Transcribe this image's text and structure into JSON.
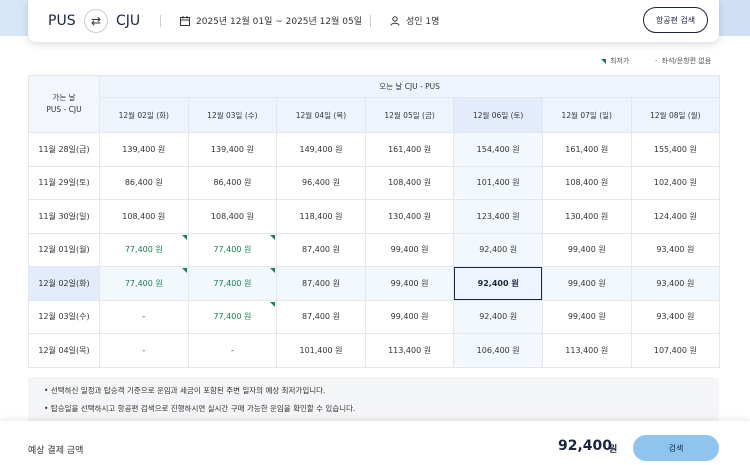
{
  "search": {
    "origin": "PUS",
    "destination": "CJU",
    "swap_icon": "⇄",
    "date_range": "2025년 12월 01일 ~ 2025년 12월 05일",
    "passengers": "성인 1명",
    "search_flight_label": "항공편 검색"
  },
  "legend": {
    "lowest_label": "최저가",
    "none_symbol": "-",
    "none_label": "좌석/운항편 없음"
  },
  "table": {
    "return_header": "오는 날 CJU - PUS",
    "corner_line1": "가는 날",
    "corner_line2": "PUS - CJU",
    "return_dates": [
      "12월 02일 (화)",
      "12월 03일 (수)",
      "12월 04일 (목)",
      "12월 05일 (금)",
      "12월 06일 (토)",
      "12월 07일 (일)",
      "12월 08일 (월)"
    ],
    "rows": [
      {
        "label": "11월 28일(금)",
        "cells": [
          "139,400 원",
          "139,400 원",
          "149,400 원",
          "161,400 원",
          "154,400 원",
          "161,400 원",
          "155,400 원"
        ]
      },
      {
        "label": "11월 29일(토)",
        "cells": [
          "86,400 원",
          "86,400 원",
          "96,400 원",
          "108,400 원",
          "101,400 원",
          "108,400 원",
          "102,400 원"
        ]
      },
      {
        "label": "11월 30일(일)",
        "cells": [
          "108,400 원",
          "108,400 원",
          "118,400 원",
          "130,400 원",
          "123,400 원",
          "130,400 원",
          "124,400 원"
        ]
      },
      {
        "label": "12월 01일(월)",
        "cells": [
          "77,400 원",
          "77,400 원",
          "87,400 원",
          "99,400 원",
          "92,400 원",
          "99,400 원",
          "93,400 원"
        ]
      },
      {
        "label": "12월 02일(화)",
        "cells": [
          "77,400 원",
          "77,400 원",
          "87,400 원",
          "99,400 원",
          "92,400 원",
          "99,400 원",
          "93,400 원"
        ]
      },
      {
        "label": "12월 03일(수)",
        "cells": [
          "-",
          "77,400 원",
          "87,400 원",
          "99,400 원",
          "92,400 원",
          "99,400 원",
          "93,400 원"
        ]
      },
      {
        "label": "12월 04일(목)",
        "cells": [
          "-",
          "-",
          "101,400 원",
          "113,400 원",
          "106,400 원",
          "113,400 원",
          "107,400 원"
        ]
      }
    ]
  },
  "notes": [
    "선택하신 일정과 탑승객 기준으로 운임과 세금이 포함된 주변 일자의 예상 최저가입니다.",
    "탑승일을 선택하시고 항공편 검색으로 진행하시면 실시간 구매 가능한 운임을 확인할 수 있습니다."
  ],
  "footer": {
    "estimate_label": "예상 결제 금액",
    "estimate_amount": "92,400",
    "estimate_unit": "원",
    "search_label": "검색"
  }
}
